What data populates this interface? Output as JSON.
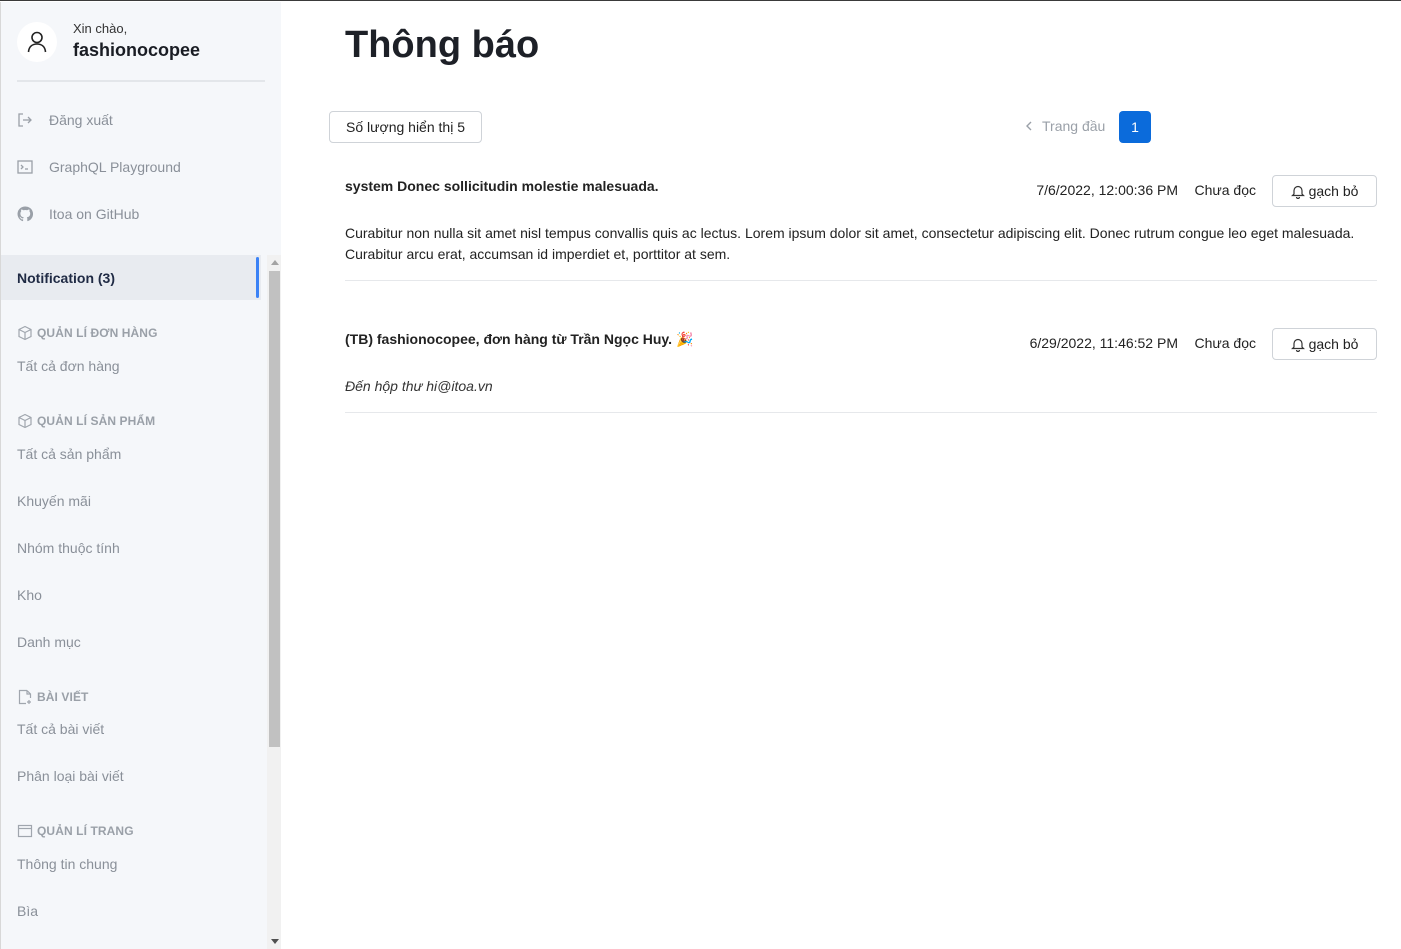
{
  "user": {
    "greeting": "Xin chào,",
    "name": "fashionocopee"
  },
  "utility_links": [
    {
      "label": "Đăng xuất",
      "icon": "logout-icon"
    },
    {
      "label": "GraphQL Playground",
      "icon": "terminal-icon"
    },
    {
      "label": "Itoa on GitHub",
      "icon": "github-icon"
    }
  ],
  "menu": {
    "active": "Notification (3)",
    "sections": [
      {
        "title": "QUẢN LÍ ĐƠN HÀNG",
        "icon": "box-icon",
        "items": [
          "Tất cả đơn hàng"
        ]
      },
      {
        "title": "QUẢN LÍ SẢN PHẨM",
        "icon": "box-icon",
        "items": [
          "Tất cả sản phẩm",
          "Khuyến mãi",
          "Nhóm thuộc tính",
          "Kho",
          "Danh mục"
        ]
      },
      {
        "title": "BÀI VIẾT",
        "icon": "post-icon",
        "items": [
          "Tất cả bài viết",
          "Phân loại bài viết"
        ]
      },
      {
        "title": "QUẢN LÍ TRANG",
        "icon": "browser-icon",
        "items": [
          "Thông tin chung",
          "Bìa"
        ]
      }
    ]
  },
  "page": {
    "title": "Thông báo",
    "page_size_label": "Số lượng hiển thị 5",
    "pager_first": "Trang đầu",
    "current_page": "1"
  },
  "notifications": [
    {
      "title": "system Donec sollicitudin molestie malesuada.",
      "time": "7/6/2022, 12:00:36 PM",
      "status": "Chưa đọc",
      "action": "gạch bỏ",
      "body": "Curabitur non nulla sit amet nisl tempus convallis quis ac lectus. Lorem ipsum dolor sit amet, consectetur adipiscing elit. Donec rutrum congue leo eget malesuada. Curabitur arcu erat, accumsan id imperdiet et, porttitor at sem."
    },
    {
      "title": "(TB) fashionocopee, đơn hàng từ Trần Ngọc Huy. 🎉",
      "time": "6/29/2022, 11:46:52 PM",
      "status": "Chưa đọc",
      "action": "gạch bỏ",
      "body": "Đến hộp thư hi@itoa.vn"
    }
  ],
  "colors": {
    "accent": "#3b82f6",
    "page_button": "#0b6bdb",
    "sidebar_bg": "#f5f7fa"
  }
}
